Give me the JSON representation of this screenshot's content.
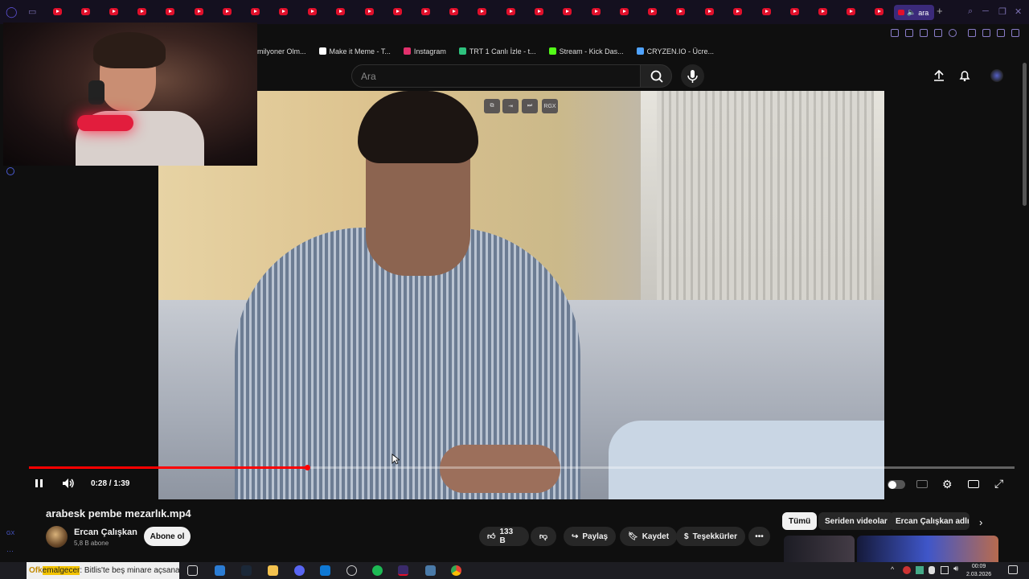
{
  "browser": {
    "active_tab_label": "ara",
    "new_tab_symbol": "+",
    "bookmarks": [
      {
        "label": "milyoner Olm...",
        "color": "#00000000"
      },
      {
        "label": "Make it Meme - T...",
        "color": "#ffffff"
      },
      {
        "label": "Instagram",
        "color": "#e1306c"
      },
      {
        "label": "TRT 1 Canlı İzle - t...",
        "color": "#2ec27e"
      },
      {
        "label": "Stream - Kick Das...",
        "color": "#53fc18"
      },
      {
        "label": "CRYZEN.IO - Ücre...",
        "color": "#4fa3ff"
      }
    ]
  },
  "youtube": {
    "search_placeholder": "Ara",
    "player": {
      "time": "0:28 / 1:39",
      "progress": 0.2828,
      "overlay_buttons": [
        "",
        "",
        "",
        "RGX"
      ]
    },
    "video_title": "arabesk pembe mezarlık.mp4",
    "channel_name": "Ercan Çalışkan",
    "subscribers": "5,8 B abone",
    "subscribe_label": "Abone ol",
    "like_count": "133 B",
    "share_label": "Paylaş",
    "save_label": "Kaydet",
    "thanks_label": "Teşekkürler",
    "more_label": "•••",
    "chips": [
      "Tümü",
      "Seriden videolar",
      "Ercan Çalışkan adlı y"
    ]
  },
  "taskbar": {
    "ticker_prefix": "Ofk",
    "ticker_highlight": "emalgecer",
    "ticker_text": ": Bitlis'te beş minare açsana la",
    "clock_time": "00:09",
    "clock_date": "2.03.2026"
  },
  "colors": {
    "accent_red": "#ff0000",
    "browser_bg": "#14101f",
    "page_bg": "#0f0f0f"
  }
}
